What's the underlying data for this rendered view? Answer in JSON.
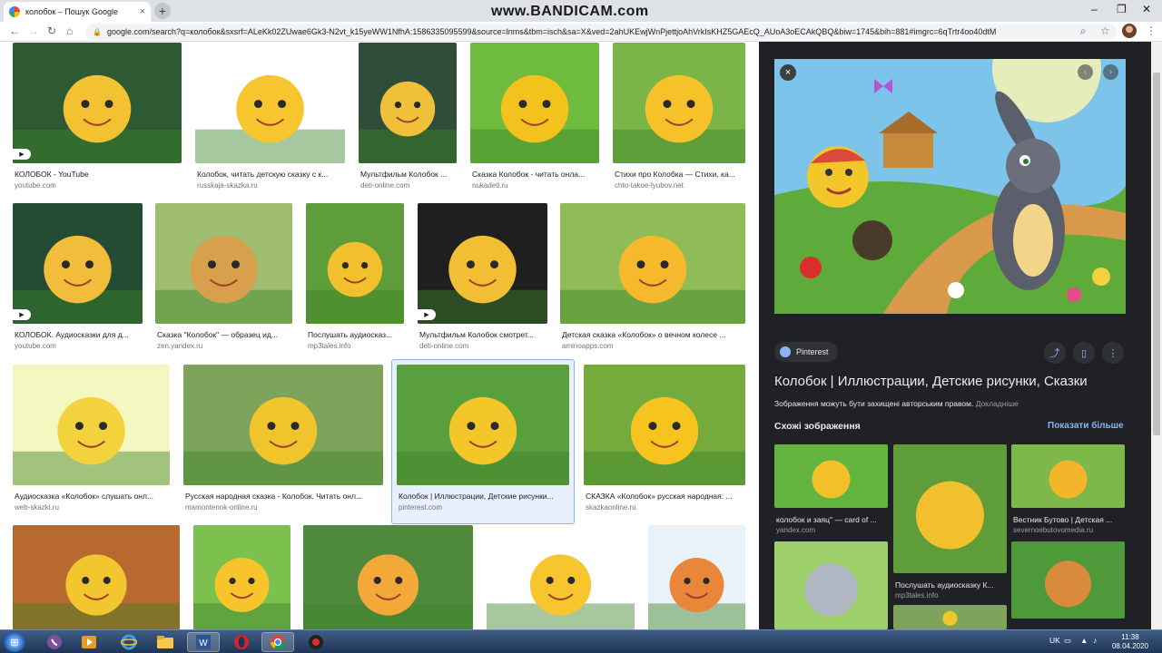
{
  "browser": {
    "tab_title": "колобок – Пошук Google",
    "tab_close": "×",
    "new_tab": "+",
    "watermark": "www.BANDICAM.com",
    "url": "google.com/search?q=колобок&sxsrf=ALeKk02ZUwae6Gk3-N2vt_k15yeWW1NfhA:1586335095599&source=lnms&tbm=isch&sa=X&ved=2ahUKEwjWnPjettjoAhVrkIsKHZ5GAEcQ_AUoA3oECAkQBQ&biw=1745&bih=881#imgrc=6qTrtr4oo40dtM"
  },
  "results": [
    {
      "title": "КОЛОБОК - YouTube",
      "source": "youtube.com",
      "video": true,
      "bg": "#2d5a32",
      "art": "#f2c233"
    },
    {
      "title": "Колобок, читать детскую сказку с к...",
      "source": "russkaja-skazka.ru",
      "video": false,
      "bg": "#ffffff",
      "art": "#f7c52e"
    },
    {
      "title": "Мультфильм Колобок ...",
      "source": "deti-online.com",
      "video": false,
      "bg": "#2e4d3a",
      "art": "#f0c03a"
    },
    {
      "title": "Сказка Колобок - читать онла...",
      "source": "nukadeti.ru",
      "video": false,
      "bg": "#6fbb3d",
      "art": "#f4c21c"
    },
    {
      "title": "Стихи про Колобка — Стихи, ка...",
      "source": "chto-takoe-lyubov.net",
      "video": false,
      "bg": "#7cb547",
      "art": "#f7c229"
    },
    {
      "title": "КОЛОБОК. Аудиосказки для д...",
      "source": "youtube.com",
      "video": true,
      "bg": "#244b34",
      "art": "#f2bd3a"
    },
    {
      "title": "Сказка \"Колобок\" — образец ид...",
      "source": "zen.yandex.ru",
      "video": false,
      "bg": "#9fbd71",
      "art": "#d8a04c"
    },
    {
      "title": "Послушать аудиосказ...",
      "source": "mp3tales.info",
      "video": false,
      "bg": "#5f9d3a",
      "art": "#f2c02c"
    },
    {
      "title": "Мультфильм Колобок смотрет...",
      "source": "deti-online.com",
      "video": true,
      "bg": "#1f1f1f",
      "art": "#f2be34"
    },
    {
      "title": "Детская сказка «Колобок» о вечном колесе ...",
      "source": "aminoapps.com",
      "video": false,
      "bg": "#8fbc56",
      "art": "#f7b92c"
    },
    {
      "title": "Аудиосказка «Колобок» слушать онл...",
      "source": "web-skazki.ru",
      "video": false,
      "bg": "#f5f7c0",
      "art": "#f2d23d"
    },
    {
      "title": "Русская народная сказка - Колобок. Читать онл...",
      "source": "mamontenok-online.ru",
      "video": false,
      "bg": "#7da45a",
      "art": "#f0c52b"
    },
    {
      "title": "Колобок | Иллюстрации, Детские рисунки...",
      "source": "pinterest.com",
      "video": false,
      "bg": "#5a9f3e",
      "art": "#f3c629"
    },
    {
      "title": "СКАЗКА «Колобок» русская народная: ...",
      "source": "skazkaonline.ru",
      "video": false,
      "bg": "#74ab3c",
      "art": "#f7c31f"
    },
    {
      "title": "",
      "source": "",
      "video": false,
      "bg": "#b8692f",
      "art": "#f2c62e"
    },
    {
      "title": "",
      "source": "",
      "video": false,
      "bg": "#7cc04d",
      "art": "#f7c52b"
    },
    {
      "title": "",
      "source": "",
      "video": false,
      "bg": "#4f8a3c",
      "art": "#f2a93a"
    },
    {
      "title": "",
      "source": "",
      "video": false,
      "bg": "#ffffff",
      "art": "#f7c52e"
    },
    {
      "title": "",
      "source": "",
      "video": false,
      "bg": "#e9f2f8",
      "art": "#e9863a"
    }
  ],
  "panel": {
    "close": "×",
    "source_name": "Pinterest",
    "title": "Колобок | Иллюстрации, Детские рисунки, Сказки",
    "copyright": "Зображення можуть бути захищені авторським правом.",
    "more": "Докладніше",
    "similar_label": "Схожі зображення",
    "show_more": "Показати більше",
    "related": [
      {
        "title": "колобок и заяц\" — card of ...",
        "source": "yandex.com",
        "bg": "#63b540",
        "art": "#f2c12a"
      },
      {
        "title": "Послушать аудиосказку К...",
        "source": "mp3tales.info",
        "bg": "#5f9d3a",
        "art": "#f2c02c"
      },
      {
        "title": "Вестник Бутово | Детская ...",
        "source": "severnoebutovomedia.ru",
        "bg": "#7fb84a",
        "art": "#f4b52a"
      },
      {
        "title": "",
        "source": "",
        "bg": "#9dcf6a",
        "art": "#b0b7c2"
      },
      {
        "title": "",
        "source": "",
        "bg": "#7da45a",
        "art": "#f0c52b"
      },
      {
        "title": "",
        "source": "",
        "bg": "#4e9a3a",
        "art": "#d98a3a"
      }
    ]
  },
  "taskbar": {
    "lang": "UK",
    "time": "11:38",
    "date": "08.04.2020"
  },
  "colors": {
    "panel_bg": "#202124",
    "link_blue": "#8ab4f8",
    "taskbar": "#1f3556"
  }
}
